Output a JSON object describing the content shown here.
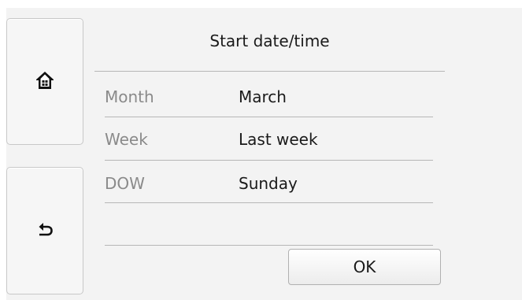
{
  "header": {
    "title": "Start date/time"
  },
  "nav": {
    "home_icon": "home-icon",
    "back_icon": "back-arrow-icon"
  },
  "rows": [
    {
      "label": "Month",
      "value": "March"
    },
    {
      "label": "Week",
      "value": "Last week"
    },
    {
      "label": "DOW",
      "value": "Sunday"
    }
  ],
  "actions": {
    "ok_label": "OK"
  }
}
